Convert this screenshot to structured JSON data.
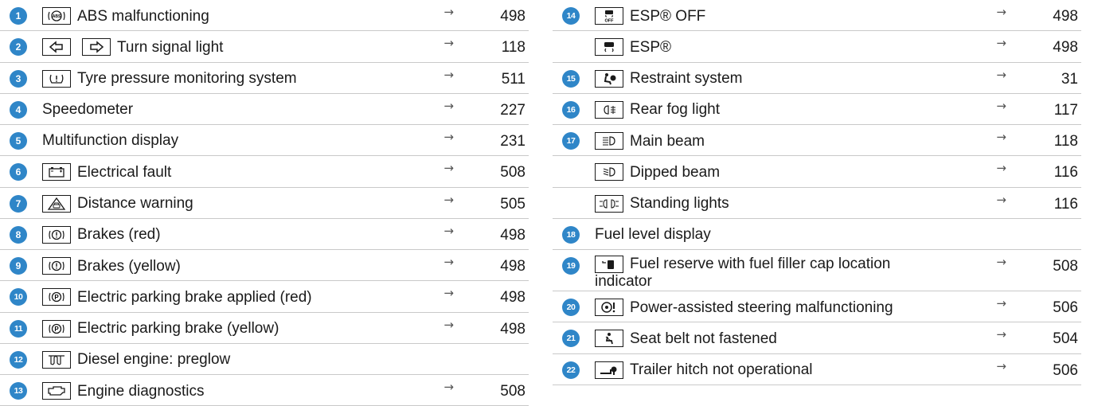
{
  "left": [
    {
      "num": "1",
      "icon": "abs-icon",
      "label": "ABS malfunctioning",
      "page": "498"
    },
    {
      "num": "2",
      "icon": "turn-signal-icons",
      "label": "Turn signal light",
      "page": "118"
    },
    {
      "num": "3",
      "icon": "tyre-pressure-icon",
      "label": "Tyre pressure monitoring system",
      "page": "511"
    },
    {
      "num": "4",
      "icon": "",
      "label": "Speedometer",
      "page": "227"
    },
    {
      "num": "5",
      "icon": "",
      "label": "Multifunction display",
      "page": "231"
    },
    {
      "num": "6",
      "icon": "battery-icon",
      "label": "Electrical fault",
      "page": "508"
    },
    {
      "num": "7",
      "icon": "distance-warning-icon",
      "label": "Distance warning",
      "page": "505"
    },
    {
      "num": "8",
      "icon": "brake-icon",
      "label": "Brakes (red)",
      "page": "498"
    },
    {
      "num": "9",
      "icon": "brake-icon",
      "label": "Brakes (yellow)",
      "page": "498"
    },
    {
      "num": "10",
      "icon": "parking-brake-icon",
      "label": "Electric parking brake applied (red)",
      "page": "498"
    },
    {
      "num": "11",
      "icon": "parking-brake-icon",
      "label": "Electric parking brake (yellow)",
      "page": "498"
    },
    {
      "num": "12",
      "icon": "preglow-icon",
      "label": "Diesel engine: preglow",
      "page": ""
    },
    {
      "num": "13",
      "icon": "engine-icon",
      "label": "Engine diagnostics",
      "page": "508"
    }
  ],
  "right": [
    {
      "num": "14",
      "icon": "esp-off-icon",
      "label": "ESP® OFF",
      "page": "498"
    },
    {
      "num": "",
      "icon": "esp-icon",
      "label": "ESP®",
      "page": "498"
    },
    {
      "num": "15",
      "icon": "restraint-icon",
      "label": "Restraint system",
      "page": "31"
    },
    {
      "num": "16",
      "icon": "rear-fog-icon",
      "label": "Rear fog light",
      "page": "117"
    },
    {
      "num": "17",
      "icon": "main-beam-icon",
      "label": "Main beam",
      "page": "118"
    },
    {
      "num": "",
      "icon": "dipped-beam-icon",
      "label": "Dipped beam",
      "page": "116"
    },
    {
      "num": "",
      "icon": "standing-lights-icon",
      "label": "Standing lights",
      "page": "116"
    },
    {
      "num": "18",
      "icon": "",
      "label": "Fuel level display",
      "page": ""
    },
    {
      "num": "19",
      "icon": "fuel-reserve-icon",
      "label": "Fuel reserve with fuel filler cap location indicator",
      "page": "508"
    },
    {
      "num": "20",
      "icon": "steering-icon",
      "label": "Power-assisted steering malfunctioning",
      "page": "506"
    },
    {
      "num": "21",
      "icon": "seat-belt-icon",
      "label": "Seat belt not fastened",
      "page": "504"
    },
    {
      "num": "22",
      "icon": "trailer-hitch-icon",
      "label": "Trailer hitch not operational",
      "page": "506"
    }
  ],
  "arrow_glyph": "→",
  "colors": {
    "badge": "#2f86c8",
    "rule": "#c9c9c9",
    "text": "#1a1a1a"
  }
}
